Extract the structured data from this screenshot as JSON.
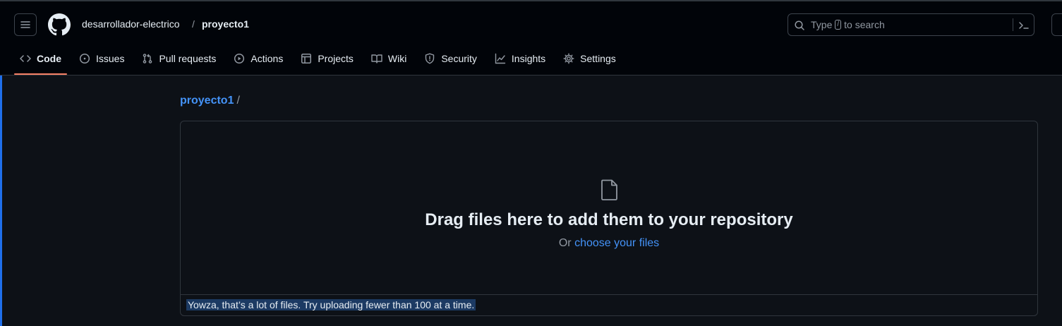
{
  "header": {
    "owner": "desarrollador-electrico",
    "separator": "/",
    "repo": "proyecto1",
    "search_placeholder_pre": "Type",
    "search_key": "/",
    "search_placeholder_post": "to search"
  },
  "tabs": [
    {
      "label": "Code",
      "icon": "code-icon",
      "active": true
    },
    {
      "label": "Issues",
      "icon": "issue-icon"
    },
    {
      "label": "Pull requests",
      "icon": "pull-request-icon"
    },
    {
      "label": "Actions",
      "icon": "play-icon"
    },
    {
      "label": "Projects",
      "icon": "table-icon"
    },
    {
      "label": "Wiki",
      "icon": "book-icon"
    },
    {
      "label": "Security",
      "icon": "shield-icon"
    },
    {
      "label": "Insights",
      "icon": "graph-icon"
    },
    {
      "label": "Settings",
      "icon": "gear-icon"
    }
  ],
  "breadcrumb": {
    "repo": "proyecto1",
    "separator": "/"
  },
  "upload": {
    "title": "Drag files here to add them to your repository",
    "or_text": "Or",
    "choose_link": "choose your files",
    "error": "Yowza, that’s a lot of files. Try uploading fewer than 100 at a time."
  },
  "colors": {
    "background": "#0d1117",
    "header": "#010409",
    "accent_link": "#4493f8",
    "active_tab_underline": "#f78166",
    "selection": "#1c3a63"
  }
}
